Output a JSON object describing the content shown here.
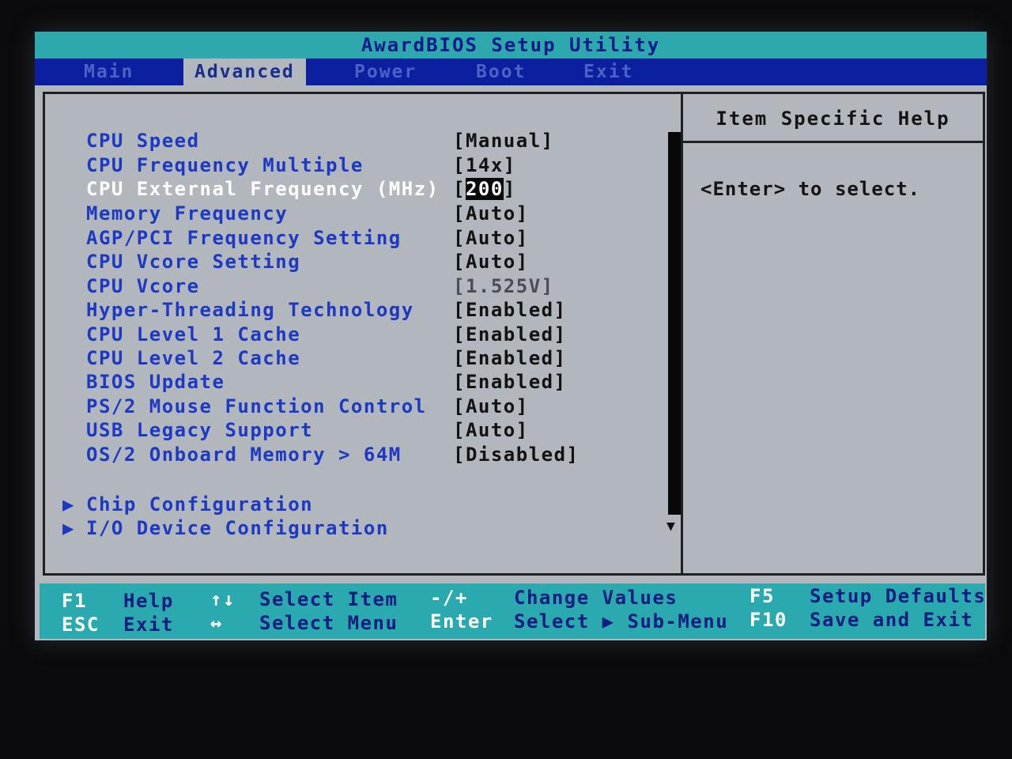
{
  "app": {
    "title": "AwardBIOS Setup Utility"
  },
  "menu": [
    {
      "label": "Main"
    },
    {
      "label": "Advanced"
    },
    {
      "label": "Power"
    },
    {
      "label": "Boot"
    },
    {
      "label": "Exit"
    }
  ],
  "settings": [
    {
      "label": "CPU Speed",
      "value": "[Manual]"
    },
    {
      "label": "CPU Frequency Multiple",
      "value": "[14x]"
    },
    {
      "label": "CPU External Frequency (MHz)",
      "value_open": "[",
      "value_cursor": "200",
      "value_close": "]"
    },
    {
      "label": "Memory Frequency",
      "value": "[Auto]"
    },
    {
      "label": "AGP/PCI Frequency Setting",
      "value": "[Auto]"
    },
    {
      "label": "CPU Vcore Setting",
      "value": "[Auto]"
    },
    {
      "label": "CPU Vcore",
      "value": "[1.525V]"
    },
    {
      "label": "Hyper-Threading Technology",
      "value": "[Enabled]"
    },
    {
      "label": "CPU Level 1 Cache",
      "value": "[Enabled]"
    },
    {
      "label": "CPU Level 2 Cache",
      "value": "[Enabled]"
    },
    {
      "label": "BIOS Update",
      "value": "[Enabled]"
    },
    {
      "label": "PS/2 Mouse Function Control",
      "value": "[Auto]"
    },
    {
      "label": "USB Legacy Support",
      "value": "[Auto]"
    },
    {
      "label": "OS/2 Onboard Memory > 64M",
      "value": "[Disabled]"
    }
  ],
  "submenus": [
    {
      "arrow": "▶",
      "label": "Chip Configuration"
    },
    {
      "arrow": "▶",
      "label": "I/O Device Configuration"
    }
  ],
  "scroll": {
    "down_arrow": "▼"
  },
  "help": {
    "title": "Item Specific Help",
    "text": "<Enter> to select."
  },
  "footer": {
    "f1_key": "F1",
    "f1_desc": "Help",
    "esc_key": "ESC",
    "esc_desc": "Exit",
    "updown_key": "↑↓",
    "updown_desc": "Select Item",
    "leftright_key": "↔",
    "leftright_desc": "Select Menu",
    "change_key": "-/+",
    "change_desc": "Change Values",
    "enter_key": "Enter",
    "enter_desc": "Select ▶ Sub-Menu",
    "f5_key": "F5",
    "f5_desc": "Setup Defaults",
    "f10_key": "F10",
    "f10_desc": "Save and Exit"
  },
  "colors": {
    "screen_bg": "#b2b6bd",
    "title_bar": "#2da8ad",
    "menu_bar": "#0c1f9e",
    "label_blue": "#1d39c4",
    "highlight": "#ffffff"
  }
}
